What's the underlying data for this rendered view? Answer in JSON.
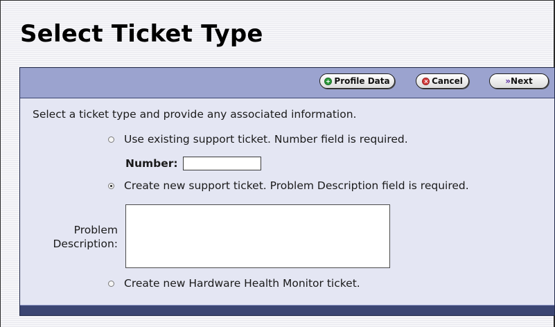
{
  "page": {
    "title": "Select Ticket Type"
  },
  "toolbar": {
    "profile_label": "Profile Data",
    "cancel_label": "Cancel",
    "next_label": "Next",
    "profile_icon": "plus-circle-icon",
    "cancel_icon": "x-circle-icon",
    "next_icon": "double-chevron-right-icon"
  },
  "form": {
    "intro": "Select a ticket type and provide any associated information.",
    "options": [
      {
        "label": "Use existing support ticket. Number field is required.",
        "selected": false
      },
      {
        "label": "Create new support ticket. Problem Description field is required.",
        "selected": true
      },
      {
        "label": "Create new Hardware Health Monitor ticket.",
        "selected": false
      }
    ],
    "number_label": "Number:",
    "number_value": "",
    "problem_label_line1": "Problem",
    "problem_label_line2": "Description:",
    "problem_value": ""
  },
  "colors": {
    "toolbar_bg": "#9ba3cf",
    "panel_bg": "#e4e6f3",
    "footer_bg": "#3c4673",
    "profile_icon": "#2e9a3c",
    "cancel_icon": "#d43b3b",
    "next_icon": "#5a2ea0"
  }
}
